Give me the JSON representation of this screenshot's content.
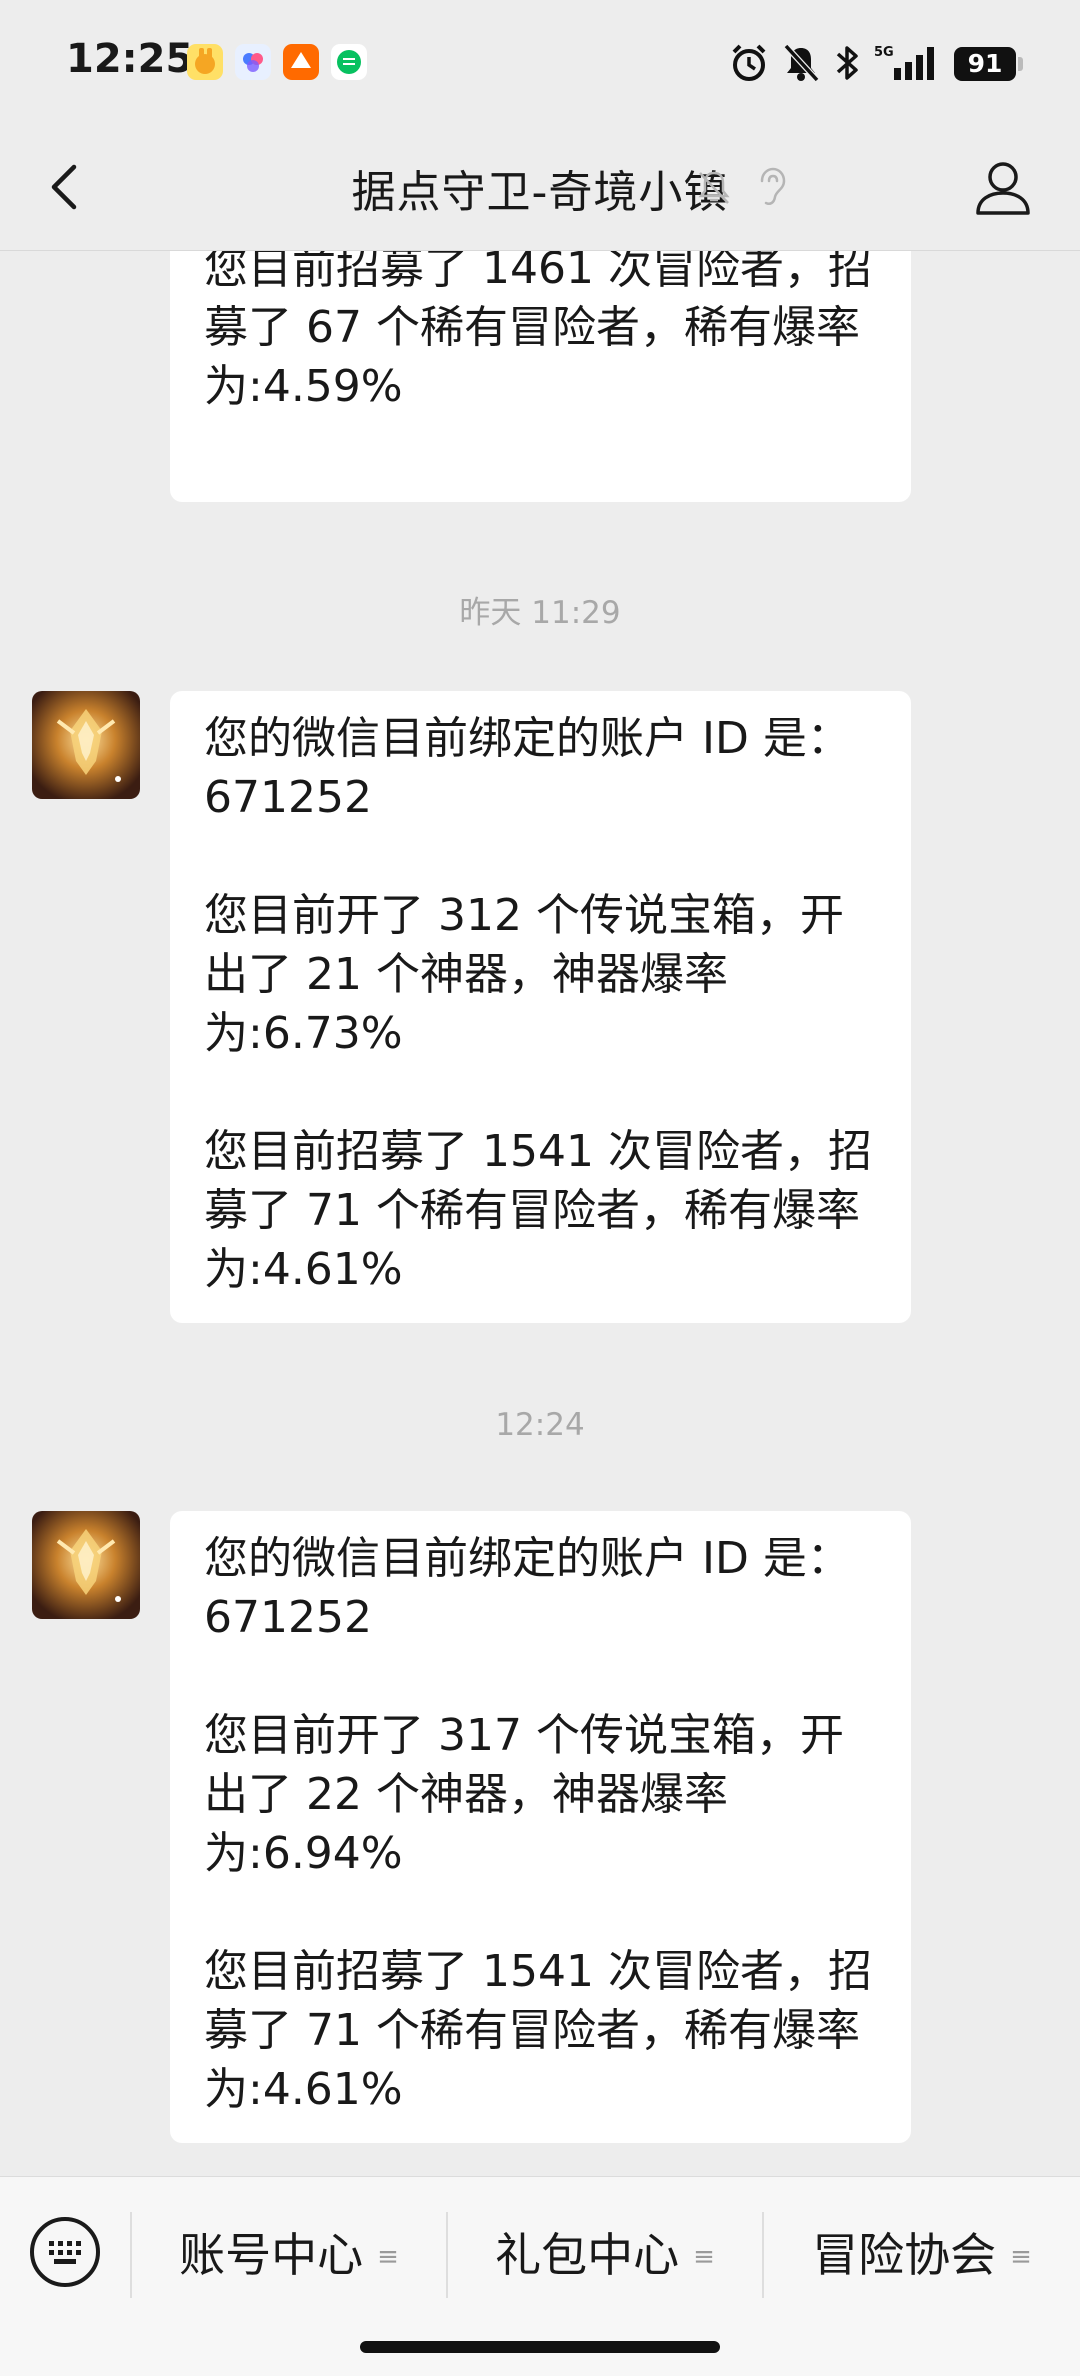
{
  "status_bar": {
    "time": "12:25",
    "battery": "91",
    "network": "5G",
    "app_icons": [
      "doll-app-icon",
      "flower-app-icon",
      "1688-app-icon",
      "wechat-app-icon"
    ],
    "system_icons": [
      "alarm-icon",
      "mute-icon",
      "bluetooth-icon",
      "signal-icon",
      "battery-icon"
    ]
  },
  "nav": {
    "title": "据点守卫-奇境小镇",
    "back_icon": "chevron-left-icon",
    "profile_icon": "person-icon"
  },
  "messages": [
    {
      "paragraphs": [
        "您目前招募了 1461 次冒险者，招募了 67 个稀有冒险者，稀有爆率为:4.59%"
      ]
    },
    {
      "timestamp": "昨天 11:29",
      "paragraphs": [
        "您的微信目前绑定的账户 ID 是：671252",
        "您目前开了 312 个传说宝箱，开出了 21 个神器，神器爆率为:6.73%",
        "您目前招募了 1541 次冒险者，招募了 71 个稀有冒险者，稀有爆率为:4.61%"
      ]
    },
    {
      "timestamp": "12:24",
      "paragraphs": [
        "您的微信目前绑定的账户 ID 是：671252",
        "您目前开了 317 个传说宝箱，开出了 22 个神器，神器爆率为:6.94%",
        "您目前招募了 1541 次冒险者，招募了 71 个稀有冒险者，稀有爆率为:4.61%"
      ]
    }
  ],
  "menu": {
    "keyboard_icon": "keyboard-icon",
    "items": [
      {
        "label": "账号中心",
        "icon": "menu-lines-icon"
      },
      {
        "label": "礼包中心",
        "icon": "menu-lines-icon"
      },
      {
        "label": "冒险协会",
        "icon": "menu-lines-icon"
      }
    ]
  },
  "colors": {
    "background": "#ededed",
    "bubble": "#ffffff",
    "timestamp": "#a8a8a8",
    "text": "#191919"
  }
}
